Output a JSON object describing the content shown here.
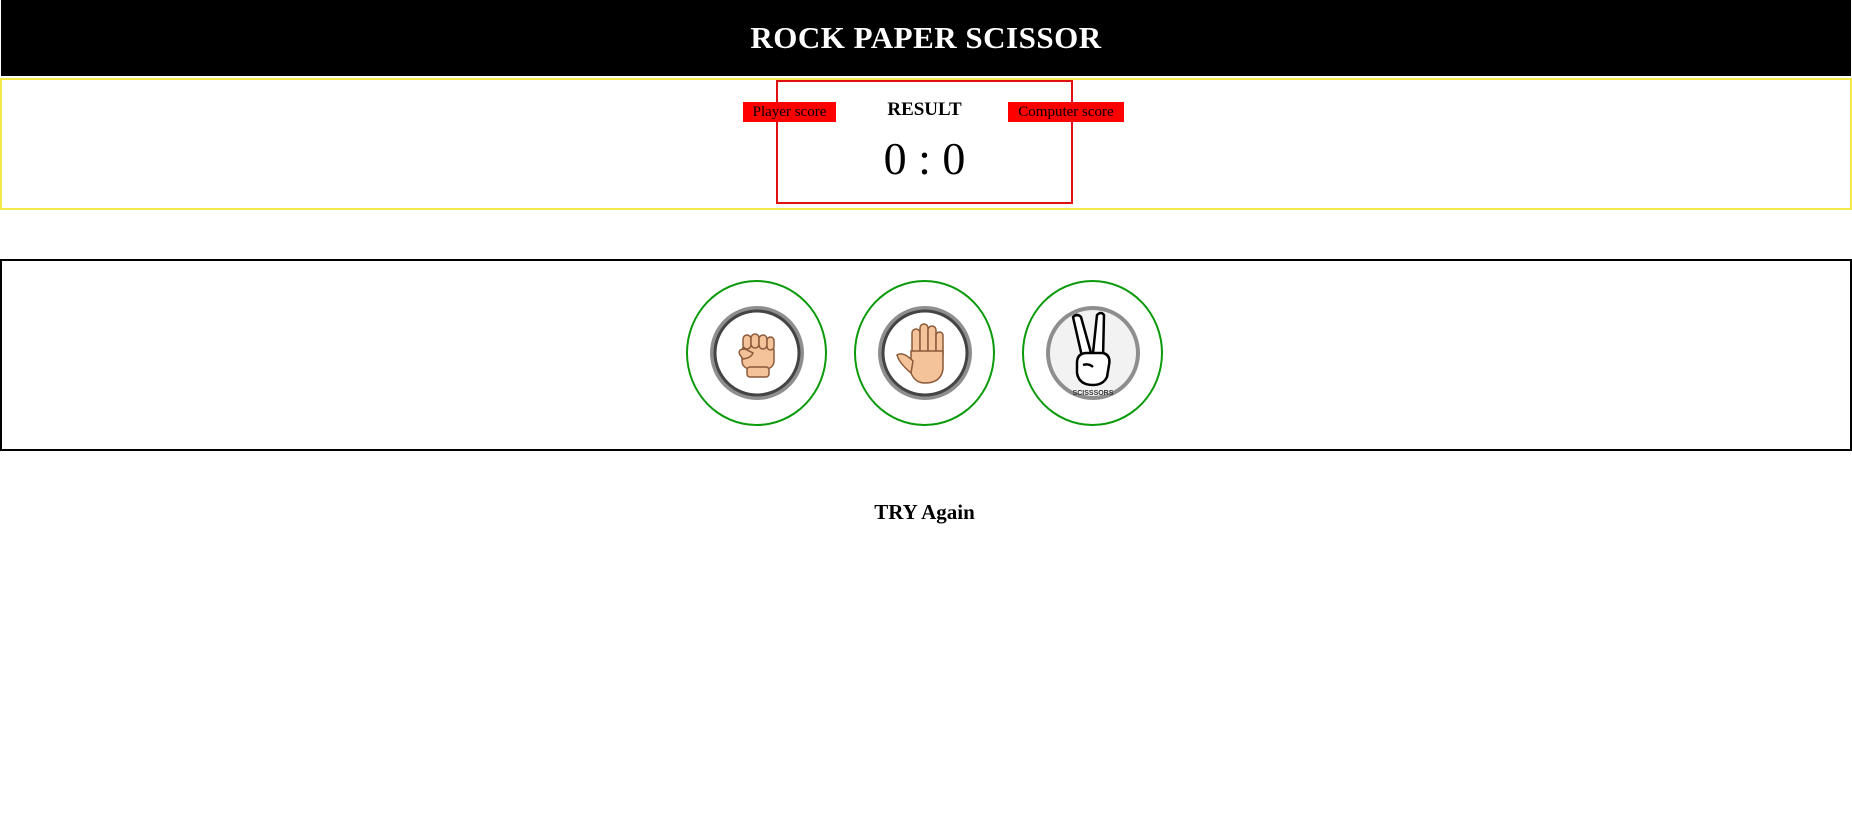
{
  "header": {
    "title": "ROCK PAPER SCISSOR"
  },
  "scoreboard": {
    "player_label": "Player score",
    "computer_label": "Computer score",
    "result_title": "RESULT",
    "score": "0 : 0"
  },
  "choices": [
    {
      "name": "rock",
      "icon": "fist-icon"
    },
    {
      "name": "paper",
      "icon": "open-hand-icon"
    },
    {
      "name": "scissor",
      "icon": "peace-hand-icon",
      "caption": "SCISSSORS"
    }
  ],
  "message": "TRY Again",
  "colors": {
    "header_bg": "#000000",
    "strip_border": "#f5e94a",
    "result_border": "#e01010",
    "badge_bg": "#ff0000",
    "choice_ring": "#0a9a0a"
  }
}
